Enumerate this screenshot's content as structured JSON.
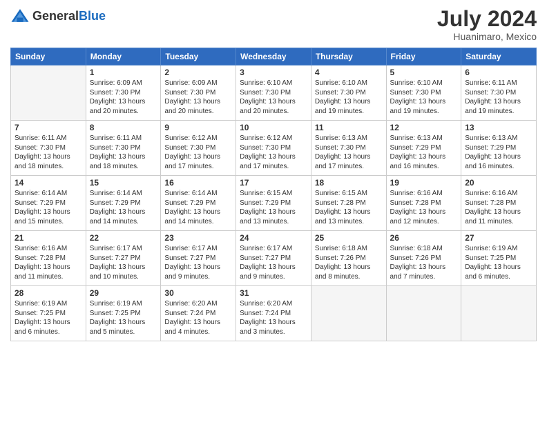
{
  "header": {
    "logo_general": "General",
    "logo_blue": "Blue",
    "month_year": "July 2024",
    "location": "Huanimaro, Mexico"
  },
  "days_of_week": [
    "Sunday",
    "Monday",
    "Tuesday",
    "Wednesday",
    "Thursday",
    "Friday",
    "Saturday"
  ],
  "weeks": [
    [
      {
        "num": "",
        "sunrise": "",
        "sunset": "",
        "daylight": ""
      },
      {
        "num": "1",
        "sunrise": "Sunrise: 6:09 AM",
        "sunset": "Sunset: 7:30 PM",
        "daylight": "Daylight: 13 hours and 20 minutes."
      },
      {
        "num": "2",
        "sunrise": "Sunrise: 6:09 AM",
        "sunset": "Sunset: 7:30 PM",
        "daylight": "Daylight: 13 hours and 20 minutes."
      },
      {
        "num": "3",
        "sunrise": "Sunrise: 6:10 AM",
        "sunset": "Sunset: 7:30 PM",
        "daylight": "Daylight: 13 hours and 20 minutes."
      },
      {
        "num": "4",
        "sunrise": "Sunrise: 6:10 AM",
        "sunset": "Sunset: 7:30 PM",
        "daylight": "Daylight: 13 hours and 19 minutes."
      },
      {
        "num": "5",
        "sunrise": "Sunrise: 6:10 AM",
        "sunset": "Sunset: 7:30 PM",
        "daylight": "Daylight: 13 hours and 19 minutes."
      },
      {
        "num": "6",
        "sunrise": "Sunrise: 6:11 AM",
        "sunset": "Sunset: 7:30 PM",
        "daylight": "Daylight: 13 hours and 19 minutes."
      }
    ],
    [
      {
        "num": "7",
        "sunrise": "Sunrise: 6:11 AM",
        "sunset": "Sunset: 7:30 PM",
        "daylight": "Daylight: 13 hours and 18 minutes."
      },
      {
        "num": "8",
        "sunrise": "Sunrise: 6:11 AM",
        "sunset": "Sunset: 7:30 PM",
        "daylight": "Daylight: 13 hours and 18 minutes."
      },
      {
        "num": "9",
        "sunrise": "Sunrise: 6:12 AM",
        "sunset": "Sunset: 7:30 PM",
        "daylight": "Daylight: 13 hours and 17 minutes."
      },
      {
        "num": "10",
        "sunrise": "Sunrise: 6:12 AM",
        "sunset": "Sunset: 7:30 PM",
        "daylight": "Daylight: 13 hours and 17 minutes."
      },
      {
        "num": "11",
        "sunrise": "Sunrise: 6:13 AM",
        "sunset": "Sunset: 7:30 PM",
        "daylight": "Daylight: 13 hours and 17 minutes."
      },
      {
        "num": "12",
        "sunrise": "Sunrise: 6:13 AM",
        "sunset": "Sunset: 7:29 PM",
        "daylight": "Daylight: 13 hours and 16 minutes."
      },
      {
        "num": "13",
        "sunrise": "Sunrise: 6:13 AM",
        "sunset": "Sunset: 7:29 PM",
        "daylight": "Daylight: 13 hours and 16 minutes."
      }
    ],
    [
      {
        "num": "14",
        "sunrise": "Sunrise: 6:14 AM",
        "sunset": "Sunset: 7:29 PM",
        "daylight": "Daylight: 13 hours and 15 minutes."
      },
      {
        "num": "15",
        "sunrise": "Sunrise: 6:14 AM",
        "sunset": "Sunset: 7:29 PM",
        "daylight": "Daylight: 13 hours and 14 minutes."
      },
      {
        "num": "16",
        "sunrise": "Sunrise: 6:14 AM",
        "sunset": "Sunset: 7:29 PM",
        "daylight": "Daylight: 13 hours and 14 minutes."
      },
      {
        "num": "17",
        "sunrise": "Sunrise: 6:15 AM",
        "sunset": "Sunset: 7:29 PM",
        "daylight": "Daylight: 13 hours and 13 minutes."
      },
      {
        "num": "18",
        "sunrise": "Sunrise: 6:15 AM",
        "sunset": "Sunset: 7:28 PM",
        "daylight": "Daylight: 13 hours and 13 minutes."
      },
      {
        "num": "19",
        "sunrise": "Sunrise: 6:16 AM",
        "sunset": "Sunset: 7:28 PM",
        "daylight": "Daylight: 13 hours and 12 minutes."
      },
      {
        "num": "20",
        "sunrise": "Sunrise: 6:16 AM",
        "sunset": "Sunset: 7:28 PM",
        "daylight": "Daylight: 13 hours and 11 minutes."
      }
    ],
    [
      {
        "num": "21",
        "sunrise": "Sunrise: 6:16 AM",
        "sunset": "Sunset: 7:28 PM",
        "daylight": "Daylight: 13 hours and 11 minutes."
      },
      {
        "num": "22",
        "sunrise": "Sunrise: 6:17 AM",
        "sunset": "Sunset: 7:27 PM",
        "daylight": "Daylight: 13 hours and 10 minutes."
      },
      {
        "num": "23",
        "sunrise": "Sunrise: 6:17 AM",
        "sunset": "Sunset: 7:27 PM",
        "daylight": "Daylight: 13 hours and 9 minutes."
      },
      {
        "num": "24",
        "sunrise": "Sunrise: 6:17 AM",
        "sunset": "Sunset: 7:27 PM",
        "daylight": "Daylight: 13 hours and 9 minutes."
      },
      {
        "num": "25",
        "sunrise": "Sunrise: 6:18 AM",
        "sunset": "Sunset: 7:26 PM",
        "daylight": "Daylight: 13 hours and 8 minutes."
      },
      {
        "num": "26",
        "sunrise": "Sunrise: 6:18 AM",
        "sunset": "Sunset: 7:26 PM",
        "daylight": "Daylight: 13 hours and 7 minutes."
      },
      {
        "num": "27",
        "sunrise": "Sunrise: 6:19 AM",
        "sunset": "Sunset: 7:25 PM",
        "daylight": "Daylight: 13 hours and 6 minutes."
      }
    ],
    [
      {
        "num": "28",
        "sunrise": "Sunrise: 6:19 AM",
        "sunset": "Sunset: 7:25 PM",
        "daylight": "Daylight: 13 hours and 6 minutes."
      },
      {
        "num": "29",
        "sunrise": "Sunrise: 6:19 AM",
        "sunset": "Sunset: 7:25 PM",
        "daylight": "Daylight: 13 hours and 5 minutes."
      },
      {
        "num": "30",
        "sunrise": "Sunrise: 6:20 AM",
        "sunset": "Sunset: 7:24 PM",
        "daylight": "Daylight: 13 hours and 4 minutes."
      },
      {
        "num": "31",
        "sunrise": "Sunrise: 6:20 AM",
        "sunset": "Sunset: 7:24 PM",
        "daylight": "Daylight: 13 hours and 3 minutes."
      },
      {
        "num": "",
        "sunrise": "",
        "sunset": "",
        "daylight": ""
      },
      {
        "num": "",
        "sunrise": "",
        "sunset": "",
        "daylight": ""
      },
      {
        "num": "",
        "sunrise": "",
        "sunset": "",
        "daylight": ""
      }
    ]
  ]
}
